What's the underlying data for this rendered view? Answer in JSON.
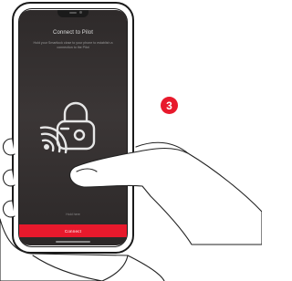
{
  "screen": {
    "title": "Connect to Pilot",
    "instruction": "Hold your Smartlock close to your phone to establish a connection to the Pilot",
    "caption": "Hold here",
    "connect_button": "Connect"
  },
  "step_badge": "3",
  "icons": {
    "lock": "padlock-icon",
    "nfc": "nfc-waves-icon"
  },
  "colors": {
    "accent": "#e8192c",
    "screen_bg": "#332f2f"
  }
}
